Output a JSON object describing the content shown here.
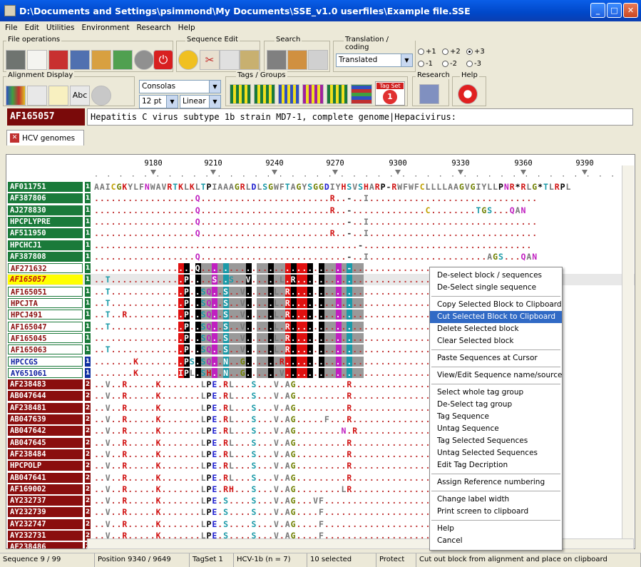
{
  "window": {
    "title": "D:\\Documents and Settings\\psimmond\\My Documents\\SSE_v1.0 userfiles\\Example file.SSE"
  },
  "menu": [
    "File",
    "Edit",
    "Utilities",
    "Environment",
    "Research",
    "Help"
  ],
  "groups": {
    "file_ops": "File operations",
    "seq_edit": "Sequence Edit",
    "search": "Search",
    "translation": "Translation / coding",
    "alignment_display": "Alignment Display",
    "tags_groups": "Tags / Groups",
    "research": "Research",
    "help": "Help"
  },
  "translation_combo": "Translated",
  "radios": [
    "+1",
    "+2",
    "+3",
    "-1",
    "-2",
    "-3"
  ],
  "font_combo": "Consolas",
  "size_combo": "12 pt",
  "mode_combo": "Linear",
  "tagset_label": "Tag Set",
  "tagset_num": "1",
  "current": {
    "id": "AF165057",
    "description": "Hepatitis C virus subtype 1b strain MD7-1, complete genome|Hepacivirus:"
  },
  "tab": "HCV genomes",
  "ruler_ticks": [
    "9180",
    "9210",
    "9240",
    "9270",
    "9300",
    "9330",
    "9360",
    "9390"
  ],
  "ruler_dots": "· · · · · · · · · · · · · · · · · · · · · · · · · · · · · · · · · · · · · · · · · · · · · · · · · · · · · · · · · · · · · · · · · · · · · · · · · · · · · · · · · · · · · · · · · · · · · · · · · · · · · · · · · · · · · · · · · · · · · · · · · · · · · · · · · · ·",
  "rows": [
    {
      "id": "AF011751",
      "tag": "1",
      "seq": "AAICGKYLFNWAVRTKLKLTPIAAAGRLDLSGWFTAGYSGGDIYHSVSHARP-RWFWFCLLLLAAGVGIYLLPNR*RLG*TLRPL"
    },
    {
      "id": "AF387806",
      "tag": "1",
      "seq": "..................Q.......................R..-..I.............................."
    },
    {
      "id": "AJ278830",
      "tag": "1",
      "seq": "..................Q.......................R..-.............C........TGS...QAN"
    },
    {
      "id": "HPCPLYPRE",
      "tag": "1",
      "seq": "..................Q..........................-..I.............................."
    },
    {
      "id": "AF511950",
      "tag": "1",
      "seq": "..................Q.......................R..-..I.............................."
    },
    {
      "id": "HPCHCJ1",
      "tag": "1",
      "seq": "...............................................-.............................."
    },
    {
      "id": "AF387808",
      "tag": "1",
      "seq": "..................Q..........................-..I.....................AGS...QAN"
    },
    {
      "id": "AF271632",
      "tag": "1",
      "seq": "..................Q..........................-................................."
    },
    {
      "id": "AF165057",
      "tag": "1",
      "seq": "..T.............P....S..S..V.....L.R..........................TGS.P."
    },
    {
      "id": "AF165051",
      "tag": "1",
      "seq": "..T.............P..SQ..S..V.....L.R..........................TGS.P."
    },
    {
      "id": "HPCJTA",
      "tag": "1",
      "seq": "..T.............P..SQ..S..V.....L.R..........................AGS.S.QAN"
    },
    {
      "id": "HPCJ491",
      "tag": "1",
      "seq": "..T..R..........P..SQ..S..V.....L.R..........................TGS.P.QAN"
    },
    {
      "id": "AF165047",
      "tag": "1",
      "seq": "..T.............P..SQ..S..V.....L.R..........................TGS.P."
    },
    {
      "id": "AF165045",
      "tag": "1",
      "seq": "................P..SQ..S..V.....L.R..........................TGS.P..VYF"
    },
    {
      "id": "AF165063",
      "tag": "1",
      "seq": "..T.............P..SQ..S..V.....L.R..........................TGS.P."
    },
    {
      "id": "HPCCGS",
      "tag": "1",
      "seq": ".......K........PS.SQ..N..G......R..........................TV.QP.QAF"
    },
    {
      "id": "AY651061",
      "tag": "1",
      "seq": ".......K.......IPL.SH..N..G......V..........................TV.QP.QAF"
    },
    {
      "id": "AF238483",
      "tag": "2",
      "seq": "..V..R.....K.......LPE.RL...S...V.AG.........R.................SGT"
    },
    {
      "id": "AB047644",
      "tag": "2",
      "seq": "..V..R.....K.......LPE.RL...S...V.AG.........R.................SGTH*.HSI"
    },
    {
      "id": "AF238481",
      "tag": "2",
      "seq": "..V..R.....K.......LPE.RL...S...V.AG.........R.................SGT"
    },
    {
      "id": "AB047639",
      "tag": "2",
      "seq": "..V..R.....K.......LPE.RL...S...V.AG.....F...R.................SGTH*VHSI"
    },
    {
      "id": "AB047642",
      "tag": "2",
      "seq": "..V..R.....K.......LPE.RL...S...V.AG........N.R.................SGTH*.HSI"
    },
    {
      "id": "AB047645",
      "tag": "2",
      "seq": "..V..R.....K.......LPE.RL...S...V.AG.........R.................SGTH*.HSI"
    },
    {
      "id": "AF238484",
      "tag": "2",
      "seq": "..V..R.....K.......LPE.RL...S...V.AG.........R.................SGT"
    },
    {
      "id": "HPCPOLP",
      "tag": "2",
      "seq": "..V..R.....K.......LPE.RL...S...V.AG.........R.................SGTH*.HSI"
    },
    {
      "id": "AB047641",
      "tag": "2",
      "seq": "..V..R.....K.......LPE.RL...S...V.AG.........R.................SGTH*.HSI"
    },
    {
      "id": "AF169002",
      "tag": "2",
      "seq": "..V..R.....K.......LPE.RH...S...V.AG........LR.................SGTQ*.HSI"
    },
    {
      "id": "AY232737",
      "tag": "2",
      "seq": "..V..R.....K.......LPE.S....S...V.AG...VF......................."
    },
    {
      "id": "AY232739",
      "tag": "2",
      "seq": "..V..R.....K.......LPE.S....S...V.AG....F......................."
    },
    {
      "id": "AY232747",
      "tag": "2",
      "seq": "..V..R.....K.......LPE.S....S...V.AG....F......................."
    },
    {
      "id": "AY232731",
      "tag": "2",
      "seq": "..V..R.....K.......LPE.S....S...V.AG....F......................."
    },
    {
      "id": "AF238486",
      "tag": "2",
      "seq": "..T..R.....K.......LPE.S....S...V.AG....F.......................SGKx"
    }
  ],
  "context_menu": [
    "De-select block / sequences",
    "De-Select single sequence",
    "---",
    "Copy Selected Block to Clipboard",
    "Cut Selected Block to Clipboard",
    "Delete Selected block",
    "Clear Selected block",
    "---",
    "Paste Sequences at Cursor",
    "---",
    "View/Edit Sequence name/source",
    "---",
    "Select whole tag group",
    "De-Select tag group",
    "Tag Sequence",
    "Untag Sequence",
    "Tag Selected Sequences",
    "Untag Selected Sequences",
    "Edit Tag Decription",
    "---",
    "Assign Reference numbering",
    "---",
    "Change label width",
    "Print screen to clipboard",
    "---",
    "Help",
    "Cancel"
  ],
  "context_highlight": "Cut Selected Block to Clipboard",
  "status": {
    "sequence": "Sequence 9 / 99",
    "position": "Position 9340 / 9649",
    "tagset": "TagSet 1",
    "group": "HCV-1b (n = 7)",
    "selected": "10 selected",
    "protect": "Protect",
    "hint": "Cut out block from alignment and place on clipboard"
  },
  "colors": {
    "title_blue": "#0a5ee8",
    "tag1_green": "#1a7a3a",
    "tag2_red": "#8a0e0e",
    "highlight": "#316ac5",
    "selection_row": "#ffff00"
  }
}
